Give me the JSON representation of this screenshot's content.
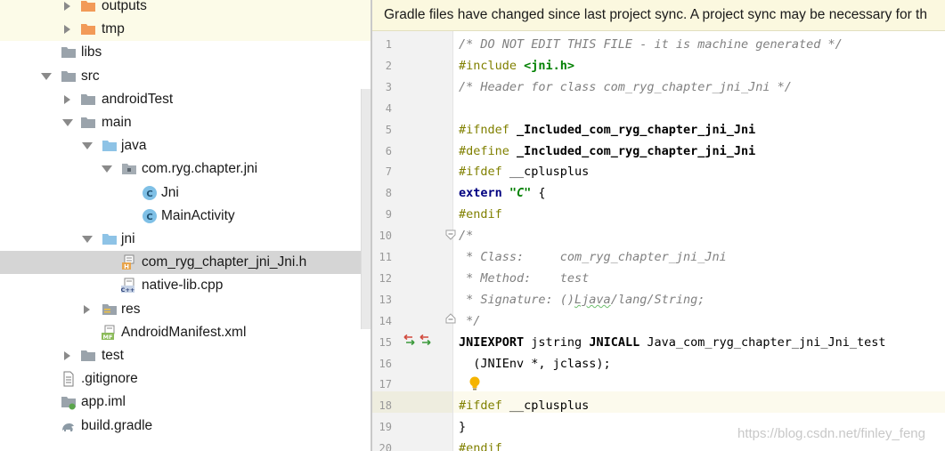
{
  "tree": {
    "items": [
      {
        "label": "outputs",
        "arrow": "right",
        "icon": "folder-orange-icon",
        "tint": true
      },
      {
        "label": "tmp",
        "arrow": "right",
        "icon": "folder-orange-icon",
        "tint": true
      },
      {
        "label": "libs",
        "arrow": "",
        "icon": "folder-gray-icon"
      },
      {
        "label": "src",
        "arrow": "down",
        "icon": "folder-gray-icon"
      },
      {
        "label": "androidTest",
        "arrow": "right",
        "icon": "folder-gray-icon"
      },
      {
        "label": "main",
        "arrow": "down",
        "icon": "folder-gray-icon"
      },
      {
        "label": "java",
        "arrow": "down",
        "icon": "folder-blue-icon"
      },
      {
        "label": "com.ryg.chapter.jni",
        "arrow": "down",
        "icon": "package-icon"
      },
      {
        "label": "Jni",
        "arrow": "",
        "icon": "class-icon"
      },
      {
        "label": "MainActivity",
        "arrow": "",
        "icon": "class-icon"
      },
      {
        "label": "jni",
        "arrow": "down",
        "icon": "folder-blue-icon"
      },
      {
        "label": "com_ryg_chapter_jni_Jni.h",
        "arrow": "",
        "icon": "header-file-icon",
        "selected": true
      },
      {
        "label": "native-lib.cpp",
        "arrow": "",
        "icon": "cpp-file-icon"
      },
      {
        "label": "res",
        "arrow": "right",
        "icon": "res-folder-icon"
      },
      {
        "label": "AndroidManifest.xml",
        "arrow": "",
        "icon": "manifest-file-icon"
      },
      {
        "label": "test",
        "arrow": "right",
        "icon": "folder-gray-icon"
      },
      {
        "label": ".gitignore",
        "arrow": "",
        "icon": "text-file-icon"
      },
      {
        "label": "app.iml",
        "arrow": "",
        "icon": "module-file-icon"
      },
      {
        "label": "build.gradle",
        "arrow": "",
        "icon": "gradle-file-icon"
      }
    ]
  },
  "banner": {
    "text": "Gradle files have changed since last project sync. A project sync may be necessary for th"
  },
  "editor": {
    "line_numbers": [
      "1",
      "2",
      "3",
      "4",
      "5",
      "6",
      "7",
      "8",
      "9",
      "10",
      "11",
      "12",
      "13",
      "14",
      "15",
      "16",
      "17",
      "18",
      "19",
      "20"
    ],
    "gutter_icons": [
      "fold-icon",
      "fold-icon",
      "implements-arrows-icon",
      "intention-bulb-icon"
    ],
    "colors": {
      "comment": "#808080",
      "preprocessor": "#808000",
      "keyword": "#000080",
      "string": "#008000",
      "caret_row": "#fcfaed"
    },
    "lines": [
      [
        {
          "t": "/* DO NOT EDIT THIS FILE - it is machine generated */",
          "c": "cm"
        }
      ],
      [
        {
          "t": "#include ",
          "c": "pp"
        },
        {
          "t": "<jni.h>",
          "c": "inc"
        }
      ],
      [
        {
          "t": "/* Header for class com_ryg_chapter_jni_Jni */",
          "c": "cm"
        }
      ],
      [],
      [
        {
          "t": "#ifndef ",
          "c": "pp"
        },
        {
          "t": "_Included_com_ryg_chapter_jni_Jni",
          "c": "mac"
        }
      ],
      [
        {
          "t": "#define ",
          "c": "pp"
        },
        {
          "t": "_Included_com_ryg_chapter_jni_Jni",
          "c": "mac"
        }
      ],
      [
        {
          "t": "#ifdef ",
          "c": "pp"
        },
        {
          "t": "__cplusplus",
          "c": "ty"
        }
      ],
      [
        {
          "t": "extern ",
          "c": "kw"
        },
        {
          "t": "\"C\"",
          "c": "str"
        },
        {
          "t": " {",
          "c": "ty"
        }
      ],
      [
        {
          "t": "#endif",
          "c": "pp"
        }
      ],
      [
        {
          "t": "/*",
          "c": "cm"
        }
      ],
      [
        {
          "t": " * Class:     com_ryg_chapter_jni_Jni",
          "c": "cm"
        }
      ],
      [
        {
          "t": " * Method:    test",
          "c": "cm"
        }
      ],
      [
        {
          "t": " * Signature: ()",
          "c": "cm"
        },
        {
          "t": "Ljava",
          "c": "cm squig"
        },
        {
          "t": "/lang/String;",
          "c": "cm"
        }
      ],
      [
        {
          "t": " */",
          "c": "cm"
        }
      ],
      [
        {
          "t": "JNIEXPORT",
          "c": "mac"
        },
        {
          "t": " jstring ",
          "c": "ty"
        },
        {
          "t": "JNICALL",
          "c": "mac"
        },
        {
          "t": " Java_com_ryg_chapter_jni_Jni_test",
          "c": "ty"
        }
      ],
      [
        {
          "t": "  (JNIEnv *, jclass);",
          "c": "ty"
        }
      ],
      [],
      [
        {
          "t": "#ifdef ",
          "c": "pp"
        },
        {
          "t": "__cplusplus",
          "c": "ty"
        }
      ],
      [
        {
          "t": "}",
          "c": "ty"
        }
      ],
      [
        {
          "t": "#endif",
          "c": "pp"
        }
      ]
    ]
  },
  "watermark": "https://blog.csdn.net/finley_feng"
}
